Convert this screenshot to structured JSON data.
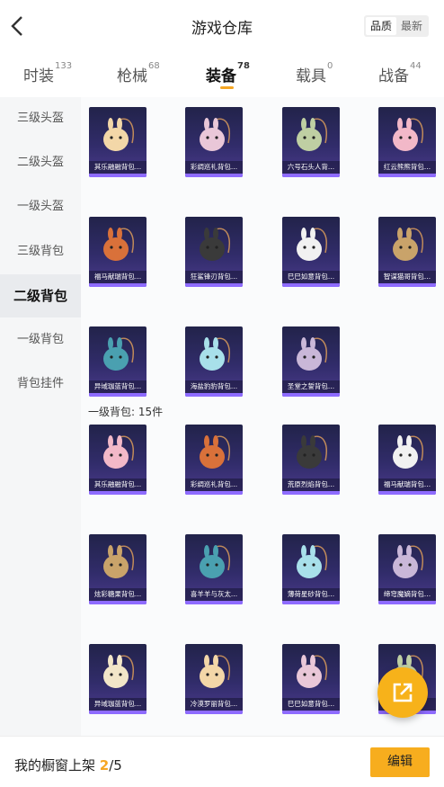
{
  "header": {
    "title": "游戏仓库",
    "sort_options": [
      "品质",
      "最新"
    ],
    "selected_sort": "品质"
  },
  "tabs": [
    {
      "label": "时装",
      "count": "133"
    },
    {
      "label": "枪械",
      "count": "68"
    },
    {
      "label": "装备",
      "count": "78"
    },
    {
      "label": "载具",
      "count": "0"
    },
    {
      "label": "战备",
      "count": "44"
    }
  ],
  "sidebar": {
    "items": [
      "三级头盔",
      "二级头盔",
      "一级头盔",
      "三级背包",
      "二级背包",
      "一级背包",
      "背包挂件"
    ],
    "active": "二级背包"
  },
  "sections": [
    {
      "label": "",
      "items": [
        "其乐融融背包...",
        "彩绸巡礼背包...",
        "六号石头人背...",
        "红云熊熊背包...",
        "福马献瑞背包...",
        "狂鲨锋刃背包...",
        "巳巳如意背包...",
        "智谋猫哥背包...",
        "异域珈蓝背包...",
        "海盐豹豹背包...",
        "圣堂之誓背包..."
      ]
    },
    {
      "label": "一级背包: 15件",
      "items": [
        "其乐融融背包...",
        "彩绸巡礼背包...",
        "荒原烈焰背包...",
        "福马献瑞背包...",
        "炫彩糖果背包...",
        "喜羊羊与灰太...",
        "薄荷星砂背包...",
        "缔穹魔嫡背包...",
        "异域珈蓝背包...",
        "冷漠罗丽背包...",
        "巳巳如意背包...",
        ""
      ]
    }
  ],
  "bottom": {
    "shelf_prefix": "我的橱窗上架 ",
    "shelf_current": "2",
    "shelf_total": "/5",
    "edit_label": "编辑"
  },
  "icons": {
    "back": "chevron-left-icon",
    "share": "external-link-icon"
  },
  "colors": {
    "accent": "#f5a623",
    "card_bar": "#8e6bff",
    "card_bg": "#2b2a5e"
  }
}
